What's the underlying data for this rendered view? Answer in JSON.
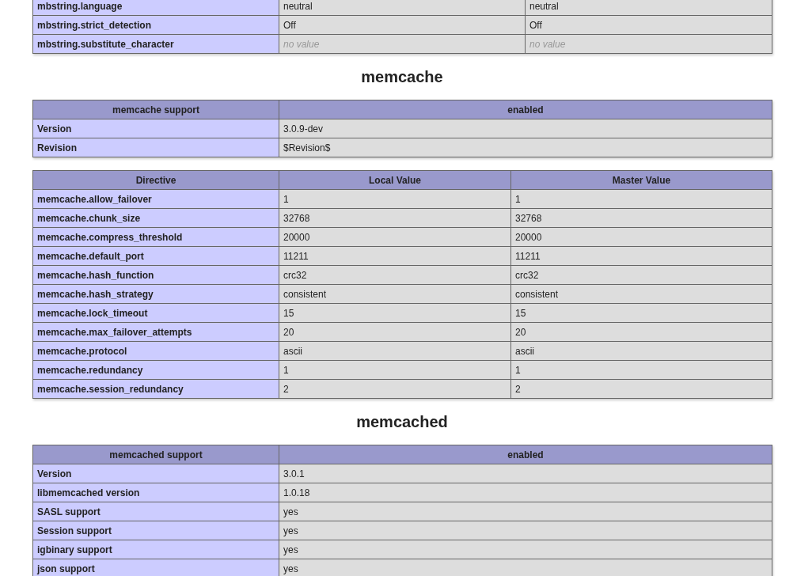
{
  "blocks": [
    {
      "kind": "table",
      "rows": [
        {
          "cells": [
            "mbstring.language",
            "neutral",
            "neutral"
          ],
          "no_value": false
        },
        {
          "cells": [
            "mbstring.strict_detection",
            "Off",
            "Off"
          ],
          "no_value": false
        },
        {
          "cells": [
            "mbstring.substitute_character",
            "no value",
            "no value"
          ],
          "no_value": true
        }
      ]
    },
    {
      "kind": "heading",
      "text": "memcache"
    },
    {
      "kind": "table",
      "header": [
        "memcache support",
        "enabled"
      ],
      "rows": [
        {
          "cells": [
            "Version",
            "3.0.9-dev"
          ]
        },
        {
          "cells": [
            "Revision",
            "$Revision$"
          ]
        }
      ]
    },
    {
      "kind": "table",
      "header": [
        "Directive",
        "Local Value",
        "Master Value"
      ],
      "rows": [
        {
          "cells": [
            "memcache.allow_failover",
            "1",
            "1"
          ]
        },
        {
          "cells": [
            "memcache.chunk_size",
            "32768",
            "32768"
          ]
        },
        {
          "cells": [
            "memcache.compress_threshold",
            "20000",
            "20000"
          ]
        },
        {
          "cells": [
            "memcache.default_port",
            "11211",
            "11211"
          ]
        },
        {
          "cells": [
            "memcache.hash_function",
            "crc32",
            "crc32"
          ]
        },
        {
          "cells": [
            "memcache.hash_strategy",
            "consistent",
            "consistent"
          ]
        },
        {
          "cells": [
            "memcache.lock_timeout",
            "15",
            "15"
          ]
        },
        {
          "cells": [
            "memcache.max_failover_attempts",
            "20",
            "20"
          ]
        },
        {
          "cells": [
            "memcache.protocol",
            "ascii",
            "ascii"
          ]
        },
        {
          "cells": [
            "memcache.redundancy",
            "1",
            "1"
          ]
        },
        {
          "cells": [
            "memcache.session_redundancy",
            "2",
            "2"
          ]
        }
      ]
    },
    {
      "kind": "heading",
      "text": "memcached"
    },
    {
      "kind": "table",
      "header": [
        "memcached support",
        "enabled"
      ],
      "rows": [
        {
          "cells": [
            "Version",
            "3.0.1"
          ]
        },
        {
          "cells": [
            "libmemcached version",
            "1.0.18"
          ]
        },
        {
          "cells": [
            "SASL support",
            "yes"
          ]
        },
        {
          "cells": [
            "Session support",
            "yes"
          ]
        },
        {
          "cells": [
            "igbinary support",
            "yes"
          ]
        },
        {
          "cells": [
            "json support",
            "yes"
          ]
        }
      ]
    }
  ]
}
